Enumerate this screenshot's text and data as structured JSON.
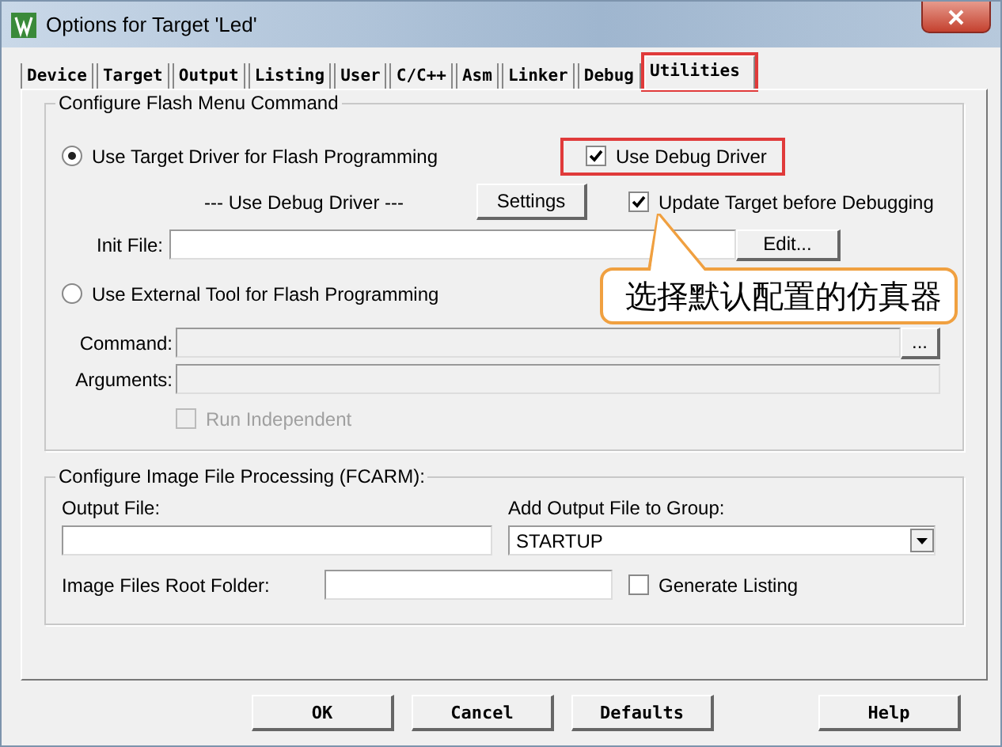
{
  "window": {
    "title": "Options for Target 'Led'"
  },
  "tabs": [
    {
      "label": "Device",
      "selected": false,
      "highlighted": false
    },
    {
      "label": "Target",
      "selected": false,
      "highlighted": false
    },
    {
      "label": "Output",
      "selected": false,
      "highlighted": false
    },
    {
      "label": "Listing",
      "selected": false,
      "highlighted": false
    },
    {
      "label": "User",
      "selected": false,
      "highlighted": false
    },
    {
      "label": "C/C++",
      "selected": false,
      "highlighted": false
    },
    {
      "label": "Asm",
      "selected": false,
      "highlighted": false
    },
    {
      "label": "Linker",
      "selected": false,
      "highlighted": false
    },
    {
      "label": "Debug",
      "selected": false,
      "highlighted": false
    },
    {
      "label": "Utilities",
      "selected": true,
      "highlighted": true
    }
  ],
  "flash_group": {
    "title": "Configure Flash Menu Command",
    "target_driver": {
      "label": "Use Target Driver for Flash Programming",
      "selected": true
    },
    "driver_caption": "--- Use Debug Driver ---",
    "settings_button": "Settings",
    "use_debug_driver": {
      "label": "Use Debug Driver",
      "checked": true,
      "highlighted": true
    },
    "update_target": {
      "label": "Update Target before Debugging",
      "checked": true
    },
    "init_file": {
      "label": "Init File:",
      "button": "Edit..."
    },
    "external_tool": {
      "label": "Use External Tool for Flash Programming",
      "selected": false
    },
    "command": {
      "label": "Command:",
      "button": "..."
    },
    "arguments": {
      "label": "Arguments:"
    },
    "run_independent": {
      "label": "Run Independent",
      "checked": false,
      "disabled": true
    }
  },
  "image_group": {
    "title": "Configure Image File Processing (FCARM):",
    "output_file": {
      "label": "Output File:"
    },
    "group": {
      "label": "Add Output File  to Group:",
      "value": "STARTUP"
    },
    "root_folder": {
      "label": "Image Files Root Folder:"
    },
    "generate_listing": {
      "label": "Generate Listing",
      "checked": false
    }
  },
  "buttons": [
    "OK",
    "Cancel",
    "Defaults",
    "Help"
  ],
  "callout": {
    "text": "选择默认配置的仿真器"
  }
}
